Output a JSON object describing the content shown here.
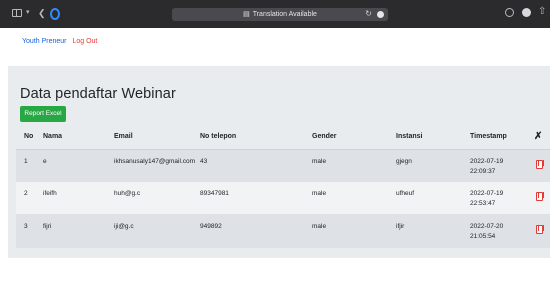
{
  "browser": {
    "url_text": "Translation Available",
    "translate_icon": "translate-icon"
  },
  "nav": {
    "home_label": "Youth Preneur",
    "logout_label": "Log Out"
  },
  "page": {
    "title": "Data pendaftar Webinar",
    "report_button": "Report Excel"
  },
  "table": {
    "columns": [
      "No",
      "Nama",
      "Email",
      "No telepon",
      "Gender",
      "Instansi",
      "Timestamp"
    ],
    "action_icon": "wrench-icon",
    "rows": [
      {
        "no": "1",
        "nama": "e",
        "email": "ikhsanusaly147@gmail.com",
        "telepon": "43",
        "gender": "male",
        "instansi": "gjegn",
        "date": "2022-07-19",
        "time": "22:09:37"
      },
      {
        "no": "2",
        "nama": "ifeifh",
        "email": "huh@g.c",
        "telepon": "89347981",
        "gender": "male",
        "instansi": "ufheuf",
        "date": "2022-07-19",
        "time": "22:53:47"
      },
      {
        "no": "3",
        "nama": "fijri",
        "email": "iji@g.c",
        "telepon": "949892",
        "gender": "male",
        "instansi": "ifjir",
        "date": "2022-07-20",
        "time": "21:05:54"
      }
    ]
  },
  "colors": {
    "link_blue": "#1560d6",
    "logout_red": "#e53935",
    "report_green": "#28a745",
    "delete_red": "#e53935"
  }
}
